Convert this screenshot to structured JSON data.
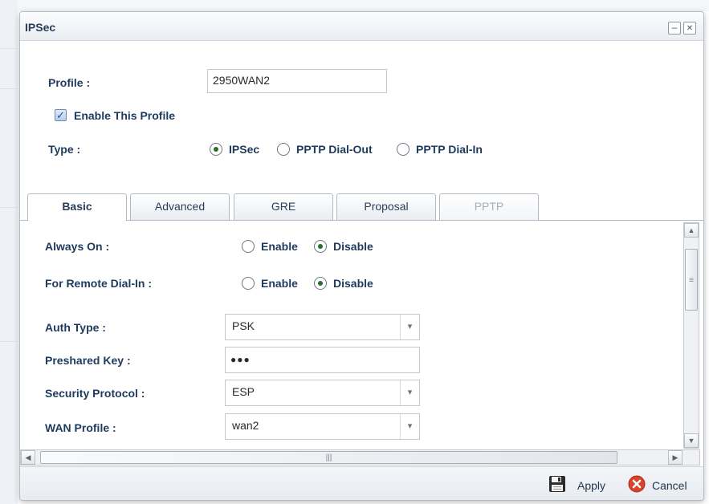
{
  "dialog": {
    "title": "IPSec"
  },
  "window_buttons": {
    "minimize": "–",
    "close": "✕"
  },
  "profile": {
    "label": "Profile :",
    "value": "2950WAN2"
  },
  "enable_profile": {
    "label": "Enable This Profile",
    "checked": true
  },
  "type": {
    "label": "Type :",
    "options": [
      "IPSec",
      "PPTP Dial-Out",
      "PPTP Dial-In"
    ],
    "selected": "IPSec"
  },
  "tabs": [
    {
      "label": "Basic",
      "state": "active"
    },
    {
      "label": "Advanced",
      "state": "normal"
    },
    {
      "label": "GRE",
      "state": "normal"
    },
    {
      "label": "Proposal",
      "state": "normal"
    },
    {
      "label": "PPTP",
      "state": "disabled"
    }
  ],
  "basic": {
    "always_on": {
      "label": "Always On :",
      "enable": "Enable",
      "disable": "Disable",
      "selected": "Disable"
    },
    "remote_dialin": {
      "label": "For Remote Dial-In :",
      "enable": "Enable",
      "disable": "Disable",
      "selected": "Disable"
    },
    "auth_type": {
      "label": "Auth Type :",
      "value": "PSK"
    },
    "preshared_key": {
      "label": "Preshared Key :",
      "value": "●●●"
    },
    "security_protocol": {
      "label": "Security Protocol :",
      "value": "ESP"
    },
    "wan_profile": {
      "label": "WAN Profile :",
      "value": "wan2"
    }
  },
  "footer": {
    "apply_label": "Apply",
    "cancel_label": "Cancel"
  },
  "icons": {
    "apply": "save-icon",
    "cancel": "cancel-icon"
  },
  "colors": {
    "cancel_icon": "#d9442b",
    "radio_dot": "#2a6f2a",
    "checkbox": "#1c4e9b"
  }
}
